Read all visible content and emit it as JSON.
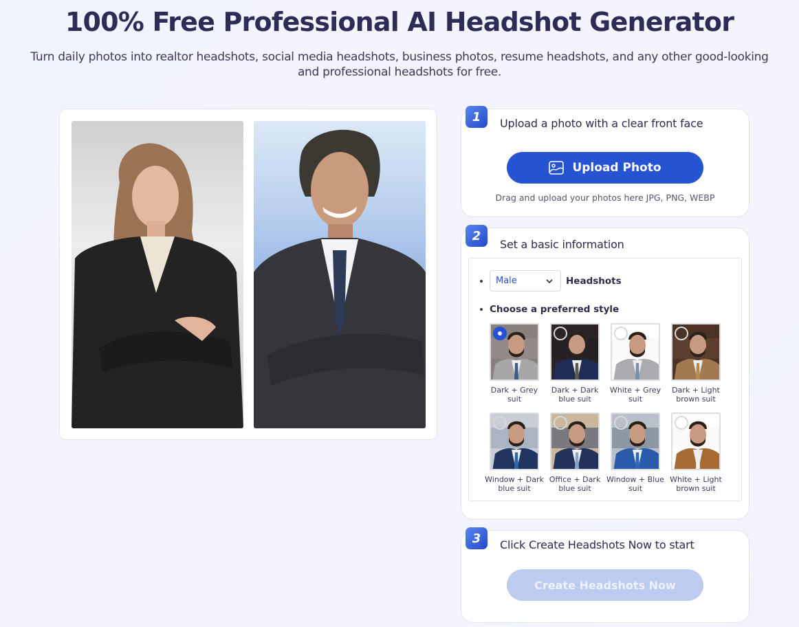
{
  "header": {
    "title": "100% Free Professional AI Headshot Generator",
    "subtitle": "Turn daily photos into realtor headshots, social media headshots, business photos, resume headshots, and any other good-looking and professional headshots for free."
  },
  "samples": [
    {
      "alt": "woman-headshot-sample"
    },
    {
      "alt": "man-headshot-sample"
    }
  ],
  "step1": {
    "number": "1",
    "title": "Upload a photo with a clear front face",
    "button_label": "Upload Photo",
    "button_icon": "image-icon",
    "hint": "Drag and upload your photos here JPG, PNG, WEBP"
  },
  "step2": {
    "number": "2",
    "title": "Set a basic information",
    "gender_select": {
      "value": "Male"
    },
    "gender_suffix": "Headshots",
    "style_prompt": "Choose a preferred style",
    "styles": [
      {
        "label": "Dark + Grey suit",
        "selected": true
      },
      {
        "label": "Dark + Dark blue suit",
        "selected": false
      },
      {
        "label": "White + Grey suit",
        "selected": false
      },
      {
        "label": "Dark + Light brown suit",
        "selected": false
      },
      {
        "label": "Window + Dark blue suit",
        "selected": false
      },
      {
        "label": "Office + Dark blue suit",
        "selected": false
      },
      {
        "label": "Window + Blue suit",
        "selected": false
      },
      {
        "label": "White + Light brown suit",
        "selected": false
      }
    ]
  },
  "step3": {
    "number": "3",
    "title": "Click Create Headshots Now to start",
    "button_label": "Create Headshots Now",
    "button_disabled": true
  },
  "colors": {
    "accent": "#2553d1",
    "disabled_button": "#bccbee",
    "title_text": "#2f2b57"
  }
}
